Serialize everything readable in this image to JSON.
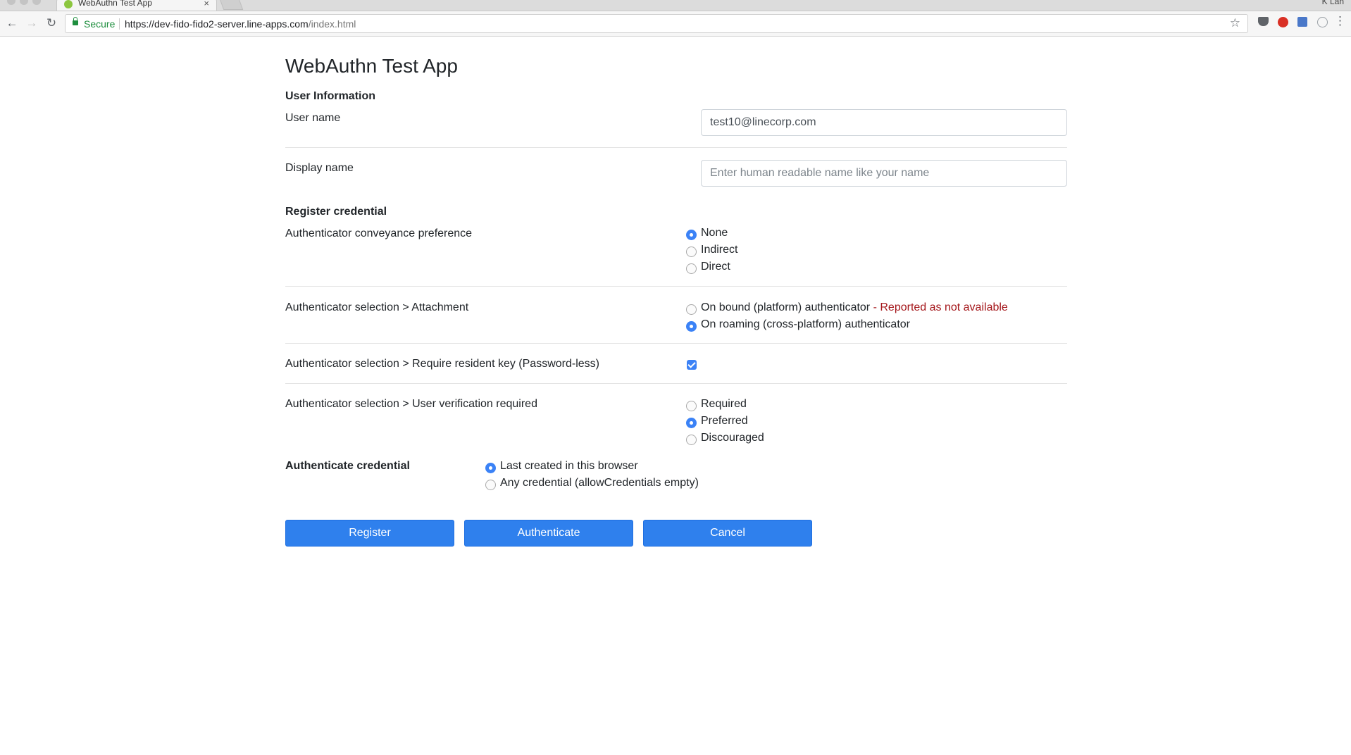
{
  "browser": {
    "tab_title": "WebAuthn Test App",
    "tab_close": "×",
    "profile_label": "K Lan",
    "security_label": "Secure",
    "url_host": "https://dev-fido-fido2-server.line-apps.com",
    "url_path": "/index.html",
    "icons": {
      "back": "←",
      "forward": "→",
      "reload": "↻",
      "bookmark": "☆",
      "menu": "⋮"
    }
  },
  "page": {
    "title": "WebAuthn Test App",
    "user_info": {
      "heading": "User Information",
      "user_name_label": "User name",
      "user_name_value": "test10@linecorp.com",
      "display_name_label": "Display name",
      "display_name_placeholder": "Enter human readable name like your name"
    },
    "register": {
      "heading": "Register credential",
      "conveyance": {
        "label": "Authenticator conveyance preference",
        "options": [
          {
            "label": "None",
            "checked": true
          },
          {
            "label": "Indirect",
            "checked": false
          },
          {
            "label": "Direct",
            "checked": false
          }
        ]
      },
      "attachment": {
        "label": "Authenticator selection > Attachment",
        "platform_label": "On bound (platform) authenticator",
        "platform_warning": " - Reported as not available",
        "roaming_label": "On roaming (cross-platform) authenticator",
        "selected": "roaming"
      },
      "resident_key": {
        "label": "Authenticator selection > Require resident key (Password-less)",
        "checked": true
      },
      "user_verification": {
        "label": "Authenticator selection > User verification required",
        "options": [
          {
            "label": "Required",
            "checked": false
          },
          {
            "label": "Preferred",
            "checked": true
          },
          {
            "label": "Discouraged",
            "checked": false
          }
        ]
      }
    },
    "authenticate": {
      "heading": "Authenticate credential",
      "options": [
        {
          "label": "Last created in this browser",
          "checked": true
        },
        {
          "label": "Any credential (allowCredentials empty)",
          "checked": false
        }
      ]
    },
    "buttons": {
      "register": "Register",
      "authenticate": "Authenticate",
      "cancel": "Cancel"
    }
  },
  "colors": {
    "accent": "#2f80ed",
    "warning": "#a4161a",
    "secure": "#1e8e3e"
  }
}
